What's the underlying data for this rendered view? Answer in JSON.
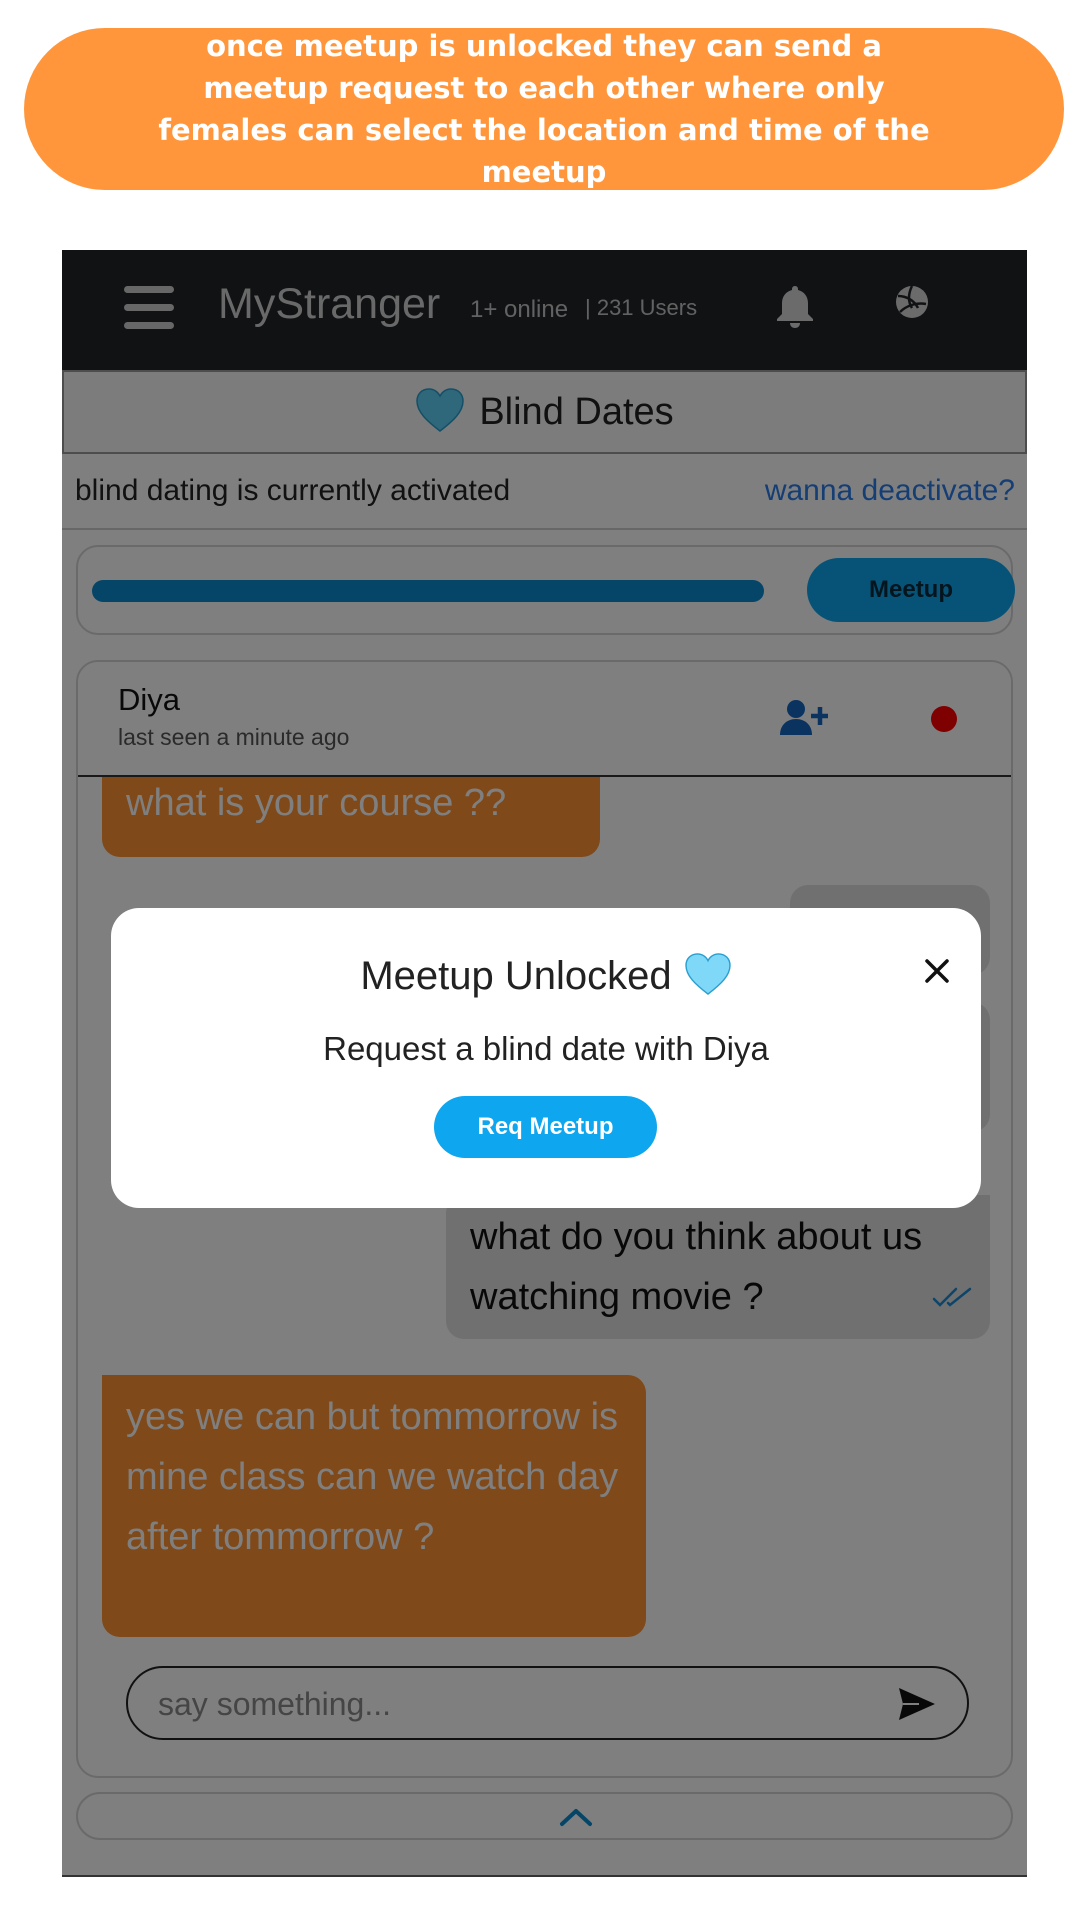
{
  "callout": {
    "text": "once meetup is unlocked they can send a meetup request to each other where only females can select the location and time of the meetup",
    "color": "#FF963C"
  },
  "header": {
    "menu_icon": "hamburger-menu-icon",
    "brand": "MyStranger",
    "online": "1+ online",
    "users": "| 231 Users",
    "bell_icon": "bell-icon",
    "profile_icon": "volleyball-avatar-icon"
  },
  "section": {
    "icon": "blue-heart-icon",
    "title": "Blind Dates"
  },
  "status": {
    "text": "blind dating is currently activated",
    "link": "wanna deactivate?"
  },
  "progress": {
    "value": 1.0,
    "button": "Meetup",
    "color": "#0a8ad0"
  },
  "chat": {
    "peer_name": "Diya",
    "peer_status": "last seen a minute ago",
    "add_friend_icon": "user-plus-icon",
    "online_dot_color": "#ff0000",
    "messages": [
      {
        "from": "peer",
        "text": "what is your course ??"
      },
      {
        "from": "me",
        "text": ""
      },
      {
        "from": "me",
        "text": ""
      },
      {
        "from": "me",
        "text": "what do you think about us watching movie ?",
        "ticks": "double-check-icon"
      },
      {
        "from": "peer",
        "text": "yes we can but tommorrow is mine class can we watch day after tommorrow ?"
      }
    ],
    "composer_placeholder": "say something...",
    "send_icon": "send-icon"
  },
  "footer": {
    "icon": "chevron-up-icon"
  },
  "modal": {
    "title": "Meetup Unlocked",
    "title_icon": "blue-heart-icon",
    "subtitle": "Request a blind date with Diya",
    "button": "Req Meetup",
    "close_icon": "close-icon"
  }
}
